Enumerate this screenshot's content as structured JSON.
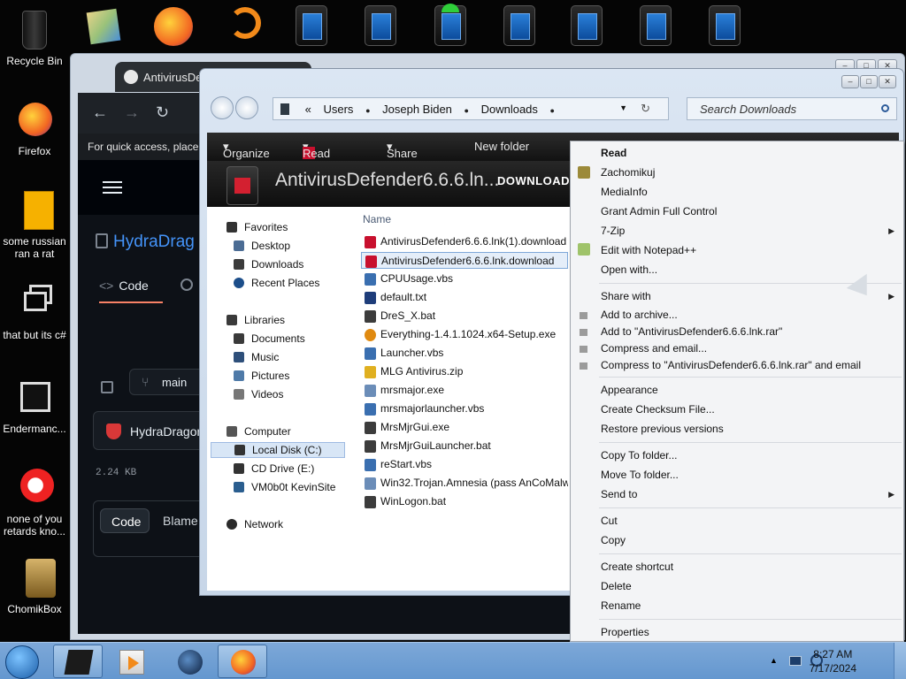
{
  "desktop": {
    "icons": [
      {
        "label": "Recycle Bin"
      },
      {
        "label": "Firefox"
      },
      {
        "label": "some russian ran a rat"
      },
      {
        "label": "that but its c#"
      },
      {
        "label": "Endermanc..."
      },
      {
        "label": "none of you retards kno..."
      },
      {
        "label": "ChomikBox"
      }
    ]
  },
  "browser": {
    "tab_title": "AntivirusDef",
    "quick_access": "For quick access, place y",
    "repo_name": "HydraDrag",
    "code_tab": "Code",
    "branch": "main",
    "hydra_label": "HydraDragon",
    "file_size": "2.24 KB",
    "code_button": "Code",
    "blame_button": "Blame"
  },
  "explorer": {
    "breadcrumb": [
      "Users",
      "Joseph Biden",
      "Downloads"
    ],
    "breadcrumb_prefix": "«",
    "search_placeholder": "Search Downloads",
    "toolbar": {
      "organize": "Organize",
      "read": "Read",
      "share_with": "Share with",
      "new_folder": "New folder"
    },
    "preview": {
      "name": "AntivirusDefender6.6.6.ln...",
      "type": "DOWNLOAD"
    },
    "nav": {
      "favorites": "Favorites",
      "desktop": "Desktop",
      "downloads": "Downloads",
      "recent": "Recent Places",
      "libraries": "Libraries",
      "documents": "Documents",
      "music": "Music",
      "pictures": "Pictures",
      "videos": "Videos",
      "computer": "Computer",
      "local_disk": "Local Disk (C:)",
      "cd_drive": "CD Drive (E:)",
      "vm": "VM0b0t KevinSite",
      "network": "Network"
    },
    "column_name": "Name",
    "files": [
      {
        "name": "AntivirusDefender6.6.6.lnk(1).download",
        "icon": "pdf-icon"
      },
      {
        "name": "AntivirusDefender6.6.6.lnk.download",
        "icon": "pdf-icon"
      },
      {
        "name": "CPUUsage.vbs",
        "icon": "vbs-icon"
      },
      {
        "name": "default.txt",
        "icon": "txt-icon"
      },
      {
        "name": "DreS_X.bat",
        "icon": "bat-icon"
      },
      {
        "name": "Everything-1.4.1.1024.x64-Setup.exe",
        "icon": "key-icon"
      },
      {
        "name": "Launcher.vbs",
        "icon": "vbs-icon"
      },
      {
        "name": "MLG Antivirus.zip",
        "icon": "zip-icon"
      },
      {
        "name": "mrsmajor.exe",
        "icon": "exe-icon"
      },
      {
        "name": "mrsmajorlauncher.vbs",
        "icon": "vbs-icon"
      },
      {
        "name": "MrsMjrGui.exe",
        "icon": "bat-icon"
      },
      {
        "name": "MrsMjrGuiLauncher.bat",
        "icon": "bat-icon"
      },
      {
        "name": "reStart.vbs",
        "icon": "vbs-icon"
      },
      {
        "name": "Win32.Trojan.Amnesia (pass AnCoMalwa",
        "icon": "exe-icon"
      },
      {
        "name": "WinLogon.bat",
        "icon": "bat-icon"
      }
    ]
  },
  "context_menu": {
    "read": "Read",
    "zachomikuj": "Zachomikuj",
    "mediainfo": "MediaInfo",
    "grant": "Grant Admin Full Control",
    "zip7": "7-Zip",
    "notepad": "Edit with Notepad++",
    "open_with": "Open with...",
    "share_with": "Share with",
    "add_archive": "Add to archive...",
    "add_rar": "Add to \"AntivirusDefender6.6.6.lnk.rar\"",
    "compress_email": "Compress and email...",
    "compress_rar_email": "Compress to \"AntivirusDefender6.6.6.lnk.rar\" and email",
    "appearance": "Appearance",
    "checksum": "Create Checksum File...",
    "restore": "Restore previous versions",
    "copy_to": "Copy To folder...",
    "move_to": "Move To folder...",
    "send_to": "Send to",
    "cut": "Cut",
    "copy": "Copy",
    "shortcut": "Create shortcut",
    "delete": "Delete",
    "rename": "Rename",
    "properties": "Properties"
  },
  "taskbar": {
    "time": "8:27 AM",
    "date": "7/17/2024"
  }
}
